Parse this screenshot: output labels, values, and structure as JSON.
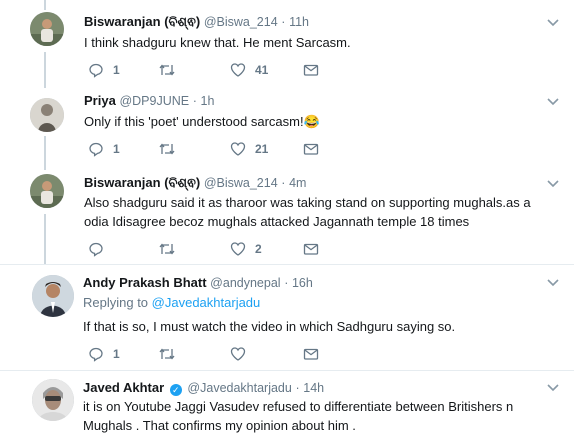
{
  "tweets": [
    {
      "name": "Biswaranjan (ବିଶ୍ଵ)",
      "handle": "@Biswa_214",
      "sep": "·",
      "time": "11h",
      "text": "I think shadguru knew that. He ment Sarcasm.",
      "replies": "1",
      "retweets": "",
      "likes": "41"
    },
    {
      "name": "Priya",
      "handle": "@DP9JUNE",
      "sep": "·",
      "time": "1h",
      "text": "Only if this 'poet' understood sarcasm!😂",
      "replies": "1",
      "retweets": "",
      "likes": "21"
    },
    {
      "name": "Biswaranjan (ବିଶ୍ଵ)",
      "handle": "@Biswa_214",
      "sep": "·",
      "time": "4m",
      "text_line1": "Also shadguru said it as tharoor was taking stand on supporting mughals.as a",
      "text_line2": "odia Idisagree becoz mughals attacked Jagannath temple 18 times",
      "replies": "",
      "retweets": "",
      "likes": "2"
    },
    {
      "name": "Andy Prakash Bhatt",
      "handle": "@andynepal",
      "sep": "·",
      "time": "16h",
      "replying_label": "Replying to",
      "replying_handle": "@Javedakhtarjadu",
      "text": "If that is so, I must watch the video in which Sadhguru saying so.",
      "replies": "1",
      "retweets": "",
      "likes": ""
    },
    {
      "name": "Javed Akhtar",
      "handle": "@Javedakhtarjadu",
      "sep": "·",
      "time": "14h",
      "text_line1": "it is on Youtube Jaggi   Vasudev refused to differentiate between Britishers n",
      "text_line2": "Mughals . That confirms my opinion about him ."
    }
  ],
  "colors": {
    "accent": "#1da1f2",
    "muted": "#657786",
    "thread_line": "#ccd6dd",
    "divider": "#e6ecf0"
  },
  "icons": [
    "reply-icon",
    "retweet-icon",
    "like-icon",
    "direct-message-icon",
    "chevron-down-icon",
    "verified-badge-icon"
  ]
}
